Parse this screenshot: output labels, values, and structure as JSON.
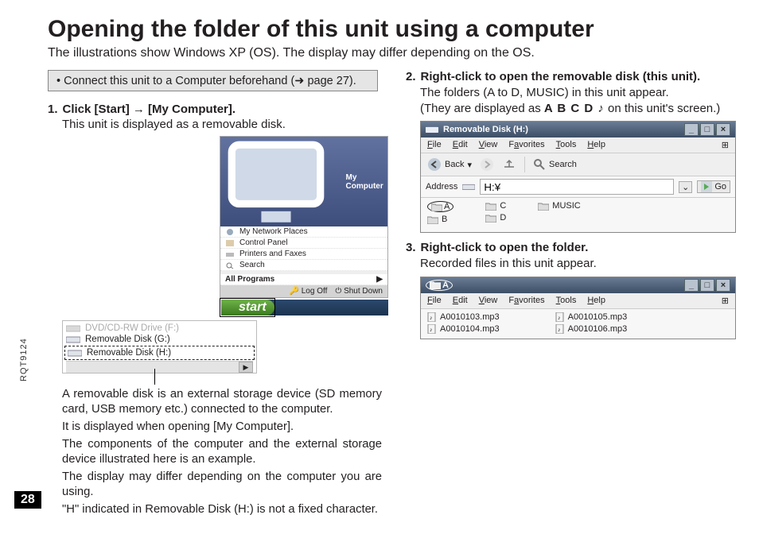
{
  "title": "Opening the folder of this unit using a computer",
  "subtitle": "The illustrations show Windows XP (OS). The display may differ depending on the OS.",
  "note": {
    "text_a": "• Connect this unit to a Computer beforehand (",
    "arrow": "➜",
    "text_b": " page 27)."
  },
  "step1": {
    "num": "1.",
    "head": "Click [Start] → [My Computer].",
    "sub": "This unit is displayed as a removable disk.",
    "start_menu": {
      "title": "My Computer",
      "items": [
        "My Network Places",
        "Control Panel",
        "Printers and Faxes",
        "Search"
      ],
      "all_programs": "All Programs",
      "logoff": "Log Off",
      "shutdown": "Shut Down",
      "start": "start"
    },
    "disks": {
      "row0": "DVD/CD-RW Drive (F:)",
      "row1": "Removable Disk (G:)",
      "row2": "Removable Disk (H:)"
    },
    "p1": "A removable disk is an external storage device (SD memory card, USB memory etc.) connected to the computer.",
    "p2": "It is displayed when opening [My Computer].",
    "p3": "The components of the computer and the external storage device illustrated here is an example.",
    "p4": "The display may differ depending on the computer you are using.",
    "p5": "\"H\" indicated in Removable Disk (H:) is not a fixed character."
  },
  "step2": {
    "num": "2.",
    "head": "Right-click to open the removable disk (this unit).",
    "sub1": "The folders (A to D, MUSIC) in this unit appear.",
    "sub2a": "(They are displayed as ",
    "glyphs": "A  B  C  D  ♪",
    "sub2b": " on this unit's screen.)",
    "win": {
      "title": "Removable Disk (H:)",
      "menu": {
        "file": "File",
        "edit": "Edit",
        "view": "View",
        "fav": "Favorites",
        "tools": "Tools",
        "help": "Help"
      },
      "back": "Back",
      "search": "Search",
      "addr_lbl": "Address",
      "addr_val": "H:¥",
      "go": "Go",
      "folders": {
        "a": "A",
        "b": "B",
        "c": "C",
        "d": "D",
        "music": "MUSIC"
      }
    }
  },
  "step3": {
    "num": "3.",
    "head": "Right-click to open the folder.",
    "sub": "Recorded files in this unit appear.",
    "win": {
      "title": "A",
      "menu": {
        "file": "File",
        "edit": "Edit",
        "view": "View",
        "fav": "Favorites",
        "tools": "Tools",
        "help": "Help"
      },
      "files": {
        "f1": "A0010103.mp3",
        "f2": "A0010104.mp3",
        "f3": "A0010105.mp3",
        "f4": "A0010106.mp3"
      }
    }
  },
  "doc_code": "RQT9124",
  "page_number": "28"
}
